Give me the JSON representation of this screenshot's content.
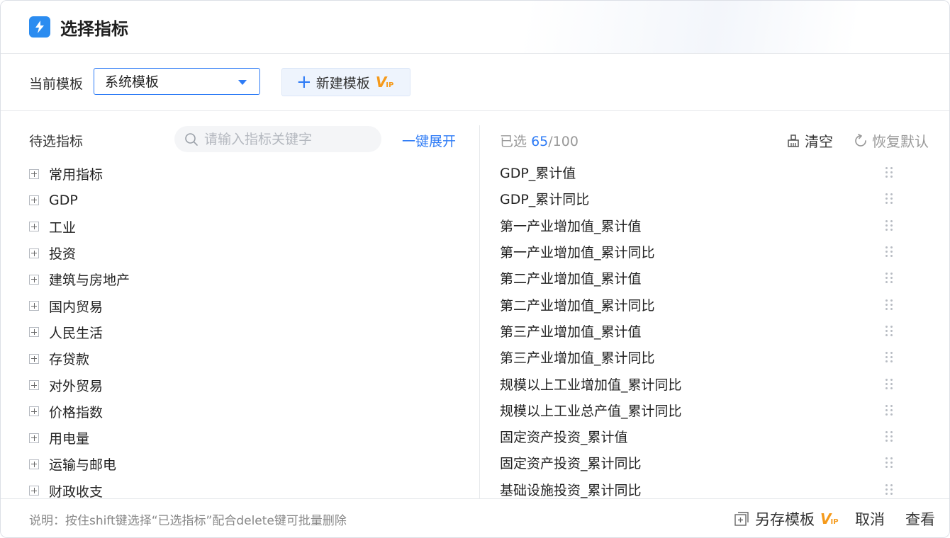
{
  "dialog": {
    "title": "选择指标"
  },
  "template": {
    "label": "当前模板",
    "selected": "系统模板",
    "new_button": "新建模板",
    "vip_badge": "VIP"
  },
  "candidates": {
    "label": "待选指标",
    "search_placeholder": "请输入指标关键字",
    "expand_all": "一键展开",
    "categories": [
      "常用指标",
      "GDP",
      "工业",
      "投资",
      "建筑与房地产",
      "国内贸易",
      "人民生活",
      "存贷款",
      "对外贸易",
      "价格指数",
      "用电量",
      "运输与邮电",
      "财政收支"
    ]
  },
  "selected": {
    "prefix": "已选",
    "count": "65",
    "total": "/100",
    "clear": "清空",
    "restore": "恢复默认",
    "items": [
      "GDP_累计值",
      "GDP_累计同比",
      "第一产业增加值_累计值",
      "第一产业增加值_累计同比",
      "第二产业增加值_累计值",
      "第二产业增加值_累计同比",
      "第三产业增加值_累计值",
      "第三产业增加值_累计同比",
      "规模以上工业增加值_累计同比",
      "规模以上工业总产值_累计同比",
      "固定资产投资_累计值",
      "固定资产投资_累计同比",
      "基础设施投资_累计同比"
    ]
  },
  "footer": {
    "hint": "说明：按住shift键选择“已选指标”配合delete键可批量删除",
    "save_as": "另存模板",
    "cancel": "取消",
    "view": "查看"
  },
  "colors": {
    "accent": "#2f7cf6",
    "vip": "#f59a1b"
  }
}
